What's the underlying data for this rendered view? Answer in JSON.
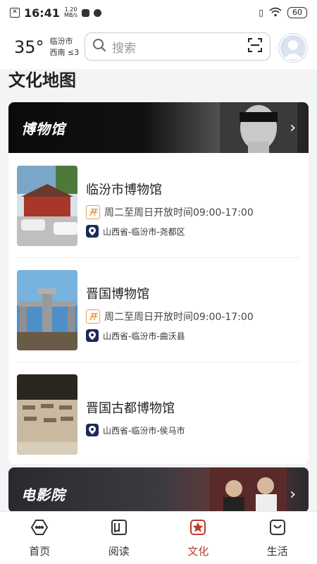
{
  "status": {
    "time": "16:41",
    "net_speed_value": "1.20",
    "net_speed_unit": "MB/s",
    "battery": "60"
  },
  "weather": {
    "temperature": "35°",
    "city": "临汾市",
    "wind": "西南 ≤3"
  },
  "search": {
    "placeholder": "搜索"
  },
  "page_title": "文化地图",
  "sections": [
    {
      "title": "博物馆",
      "items": [
        {
          "name": "临汾市博物馆",
          "hours": "周二至周日开放时间09:00-17:00",
          "location": "山西省-临汾市-尧都区"
        },
        {
          "name": "晋国博物馆",
          "hours": "周二至周日开放时间09:00-17:00",
          "location": "山西省-临汾市-曲沃县"
        },
        {
          "name": "晋国古都博物馆",
          "location": "山西省-临汾市-侯马市"
        }
      ]
    },
    {
      "title": "电影院"
    }
  ],
  "open_badge": "开",
  "nav": [
    {
      "label": "首页",
      "icon": "home-icon"
    },
    {
      "label": "阅读",
      "icon": "book-icon"
    },
    {
      "label": "文化",
      "icon": "culture-icon"
    },
    {
      "label": "生活",
      "icon": "life-icon"
    }
  ],
  "colors": {
    "accent": "#c0392b",
    "location_badge": "#1c2a5a",
    "open_badge": "#e08a30"
  }
}
